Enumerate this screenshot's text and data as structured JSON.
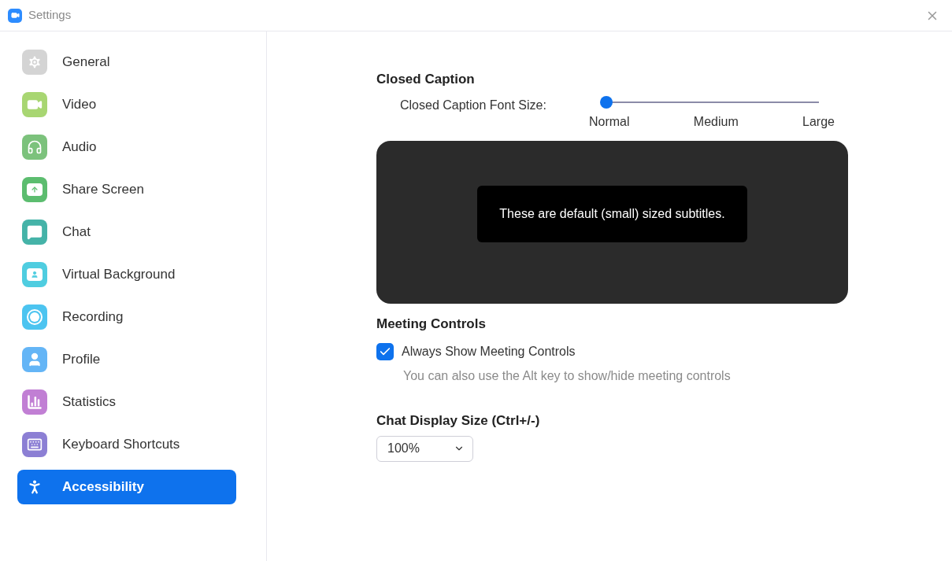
{
  "window": {
    "title": "Settings"
  },
  "sidebar": {
    "items": [
      {
        "label": "General",
        "kind": "gear",
        "color": "#d4d4d4",
        "selected": false
      },
      {
        "label": "Video",
        "kind": "video",
        "color": "#a8d672",
        "selected": false
      },
      {
        "label": "Audio",
        "kind": "headphones",
        "color": "#7cc27c",
        "selected": false
      },
      {
        "label": "Share Screen",
        "kind": "share",
        "color": "#5cbd6f",
        "selected": false
      },
      {
        "label": "Chat",
        "kind": "chat",
        "color": "#45b3a8",
        "selected": false
      },
      {
        "label": "Virtual Background",
        "kind": "background",
        "color": "#4fcde0",
        "selected": false
      },
      {
        "label": "Recording",
        "kind": "recording",
        "color": "#4cc4f0",
        "selected": false
      },
      {
        "label": "Profile",
        "kind": "profile",
        "color": "#64b5f6",
        "selected": false
      },
      {
        "label": "Statistics",
        "kind": "statistics",
        "color": "#c17fd4",
        "selected": false
      },
      {
        "label": "Keyboard Shortcuts",
        "kind": "keyboard",
        "color": "#8c7fd4",
        "selected": false
      },
      {
        "label": "Accessibility",
        "kind": "accessibility",
        "color": "#0e72ed",
        "selected": true
      }
    ]
  },
  "closed_caption": {
    "heading": "Closed Caption",
    "font_size_label": "Closed Caption Font Size:",
    "slider": {
      "level": 0,
      "ticks": [
        "Normal",
        "Medium",
        "Large"
      ]
    },
    "preview_text": "These are default (small) sized subtitles."
  },
  "meeting_controls": {
    "heading": "Meeting Controls",
    "checkbox": {
      "label": "Always Show Meeting Controls",
      "checked": true
    },
    "hint": "You can also use the Alt key to show/hide meeting controls"
  },
  "chat_display": {
    "heading": "Chat Display Size (Ctrl+/-)",
    "select": {
      "value": "100%"
    }
  }
}
